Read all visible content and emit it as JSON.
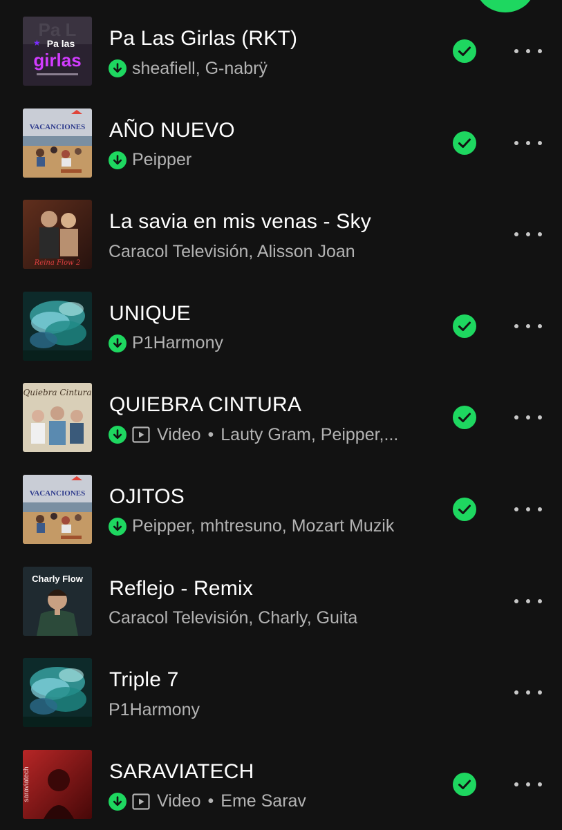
{
  "tracks": [
    {
      "title": "Pa Las Girlas (RKT)",
      "artists": "sheafiell, G-nabrÿ",
      "downloaded": true,
      "video": false,
      "saved": true,
      "cover": "cover-pa-las-girlas",
      "cover_text": [
        "Pa las",
        "girlas"
      ]
    },
    {
      "title": "AÑO NUEVO",
      "artists": "Peipper",
      "downloaded": true,
      "video": false,
      "saved": true,
      "cover": "cover-vacanciones",
      "cover_text": [
        "VACANCIONES"
      ]
    },
    {
      "title": "La savia en mis venas - Sky",
      "artists": "Caracol Televisión, Alisson Joan",
      "downloaded": false,
      "video": false,
      "saved": false,
      "cover": "cover-savia",
      "cover_text": [
        "Reina Flow 2"
      ]
    },
    {
      "title": "UNIQUE",
      "artists": "P1Harmony",
      "downloaded": true,
      "video": false,
      "saved": true,
      "cover": "cover-unique"
    },
    {
      "title": "QUIEBRA CINTURA",
      "artists": "Lauty Gram, Peipper,...",
      "downloaded": true,
      "video": true,
      "saved": true,
      "cover": "cover-quiebra",
      "cover_text": [
        "Quiebra Cintura"
      ]
    },
    {
      "title": "OJITOS",
      "artists": "Peipper, mhtresuno, Mozart Muzik",
      "downloaded": true,
      "video": false,
      "saved": true,
      "cover": "cover-vacanciones",
      "cover_text": [
        "VACANCIONES"
      ]
    },
    {
      "title": "Reflejo - Remix",
      "artists": "Caracol Televisión, Charly, Guita",
      "downloaded": false,
      "video": false,
      "saved": false,
      "cover": "cover-charly",
      "cover_text": [
        "Charly Flow"
      ]
    },
    {
      "title": "Triple 7",
      "artists": "P1Harmony",
      "downloaded": false,
      "video": false,
      "saved": false,
      "cover": "cover-unique"
    },
    {
      "title": "SARAVIATECH",
      "artists": "Eme Sarav",
      "downloaded": true,
      "video": true,
      "saved": true,
      "cover": "cover-saraviatech",
      "cover_text": [
        "saraviatech"
      ]
    }
  ],
  "labels": {
    "video": "Video",
    "separator": "•"
  },
  "colors": {
    "background": "#121212",
    "accent": "#1ed760",
    "secondary_text": "#b3b3b3"
  },
  "icons": {
    "downloaded": "download-complete-icon",
    "video": "video-icon",
    "saved": "saved-check-icon",
    "more": "more-options-icon"
  }
}
